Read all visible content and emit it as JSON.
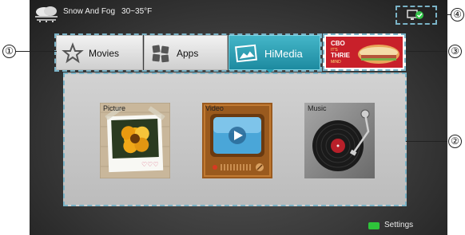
{
  "status": {
    "weather_condition": "Snow And Fog",
    "temperature_range": "30~35°F"
  },
  "tabs": [
    {
      "label": "Movies",
      "icon": "star-icon",
      "selected": false
    },
    {
      "label": "Apps",
      "icon": "apps-grid-icon",
      "selected": false
    },
    {
      "label": "HiMedia",
      "icon": "picture-icon",
      "selected": true
    }
  ],
  "media": [
    {
      "label": "Picture",
      "icon": "photo-frame-icon"
    },
    {
      "label": "Video",
      "icon": "retro-tv-icon"
    },
    {
      "label": "Music",
      "icon": "turntable-icon"
    }
  ],
  "ad_text": {
    "line1": "CBO",
    "line2": "IT'S",
    "line3": "THRIE",
    "line4": "MIND"
  },
  "settings": {
    "label": "Settings",
    "key_color": "#2ec43a"
  },
  "callouts": [
    "①",
    "②",
    "③",
    "④"
  ],
  "colors": {
    "accent": "#1d8aa0",
    "dashed_border": "#7ab3c7"
  }
}
